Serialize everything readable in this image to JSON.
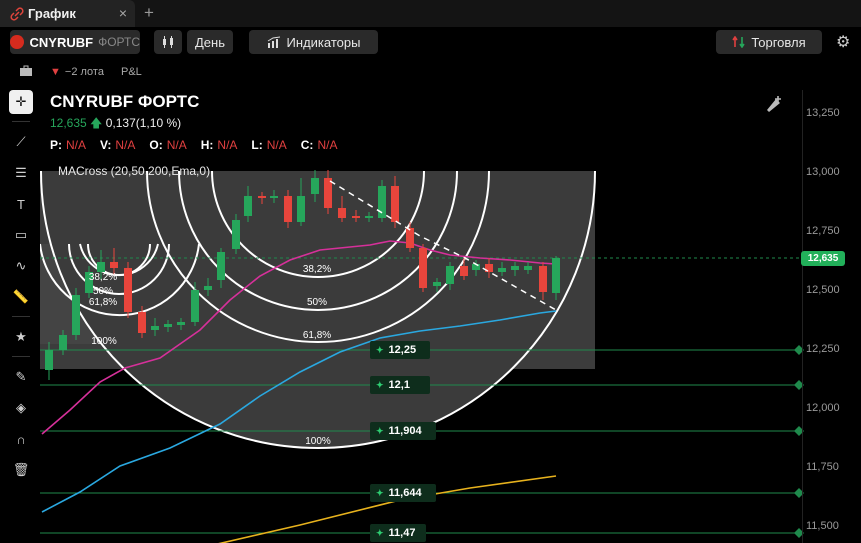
{
  "tab": {
    "title": "График",
    "close": "×",
    "add": "+"
  },
  "toolbar": {
    "symbol": "CNYRUBF",
    "exchange": "ФОРТС",
    "interval": "День",
    "indicators": "Индикаторы",
    "trade": "Торговля"
  },
  "position": {
    "qty": "−2 лота",
    "pnl": "P&L"
  },
  "legend": {
    "title": "CNYRUBF ФОРТС",
    "price": "12,635",
    "change": "0,137(1,10 %)",
    "ohlc": [
      {
        "k": "P:",
        "v": "N/A"
      },
      {
        "k": "V:",
        "v": "N/A"
      },
      {
        "k": "O:",
        "v": "N/A"
      },
      {
        "k": "H:",
        "v": "N/A"
      },
      {
        "k": "L:",
        "v": "N/A"
      },
      {
        "k": "C:",
        "v": "N/A"
      }
    ],
    "indicator": "MACross (20,50,200,Ema,0)"
  },
  "axis": {
    "ticks": [
      "13,250",
      "13,000",
      "12,750",
      "12,500",
      "12,250",
      "12,000",
      "11,750",
      "11,500"
    ],
    "last_price": "12,635"
  },
  "levels": [
    "12,25",
    "12,1",
    "11,904",
    "11,644",
    "11,47"
  ],
  "fib_small": [
    "38,2%",
    "50%",
    "61,8%",
    "100%"
  ],
  "fib_big": [
    "38,2%",
    "50%",
    "61,8%",
    "100%"
  ],
  "colors": {
    "up": "#26a65b",
    "down": "#e8453c",
    "ema20": "#d6309a",
    "ema50": "#2aa8e0",
    "ema200": "#e7b21d",
    "level": "#1f8a4c"
  }
}
